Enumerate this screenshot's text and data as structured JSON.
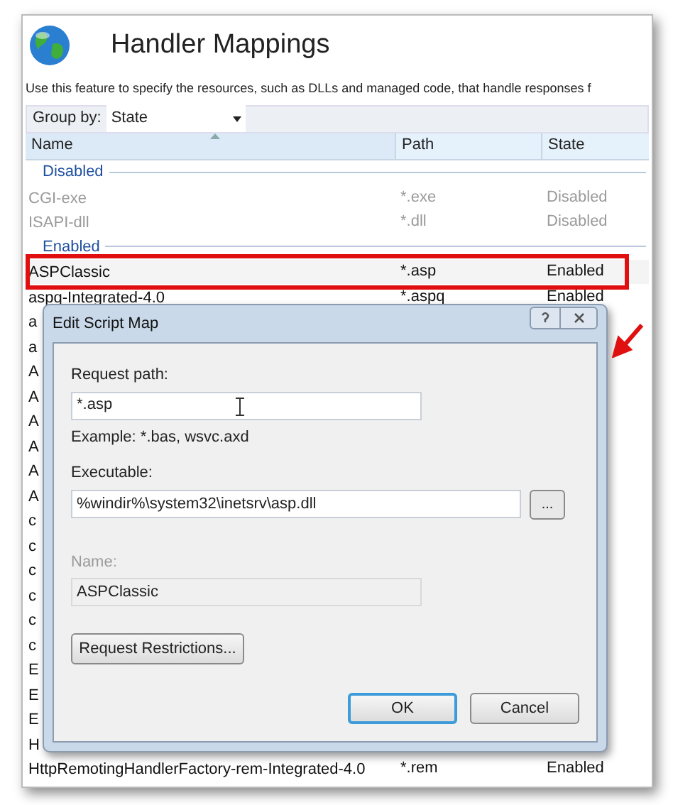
{
  "window": {
    "title": "Handler Mappings",
    "description": "Use this feature to specify the resources, such as DLLs and managed code, that handle responses f"
  },
  "toolbar": {
    "group_by_label": "Group by:",
    "group_by_value": "State"
  },
  "table": {
    "columns": [
      {
        "label": "Name",
        "sorted": true
      },
      {
        "label": "Path",
        "sorted": false
      },
      {
        "label": "State",
        "sorted": false
      }
    ],
    "rows": [
      {
        "kind": "group",
        "label": "Disabled"
      },
      {
        "kind": "item",
        "name": "CGI-exe",
        "path": "*.exe",
        "state": "Disabled",
        "disabled": true,
        "highlighted": false
      },
      {
        "kind": "item",
        "name": "ISAPI-dll",
        "path": "*.dll",
        "state": "Disabled",
        "disabled": true,
        "highlighted": false
      },
      {
        "kind": "group",
        "label": "Enabled"
      },
      {
        "kind": "item",
        "name": "ASPClassic",
        "path": "*.asp",
        "state": "Enabled",
        "disabled": false,
        "highlighted": true
      },
      {
        "kind": "item",
        "name": "aspq-Integrated-4.0",
        "path": "*.aspq",
        "state": "Enabled",
        "disabled": false,
        "highlighted": false
      },
      {
        "kind": "item",
        "name": "a",
        "disabled": false,
        "highlighted": false
      },
      {
        "kind": "item",
        "name": "a",
        "disabled": false,
        "highlighted": false
      },
      {
        "kind": "item",
        "name": "A",
        "disabled": false,
        "highlighted": false
      },
      {
        "kind": "item",
        "name": "A",
        "disabled": false,
        "highlighted": false
      },
      {
        "kind": "item",
        "name": "A",
        "disabled": false,
        "highlighted": false
      },
      {
        "kind": "item",
        "name": "A",
        "disabled": false,
        "highlighted": false
      },
      {
        "kind": "item",
        "name": "A",
        "disabled": false,
        "highlighted": false
      },
      {
        "kind": "item",
        "name": "A",
        "disabled": false,
        "highlighted": false
      },
      {
        "kind": "item",
        "name": "c",
        "disabled": false,
        "highlighted": false
      },
      {
        "kind": "item",
        "name": "c",
        "disabled": false,
        "highlighted": false
      },
      {
        "kind": "item",
        "name": "c",
        "disabled": false,
        "highlighted": false
      },
      {
        "kind": "item",
        "name": "c",
        "disabled": false,
        "highlighted": false
      },
      {
        "kind": "item",
        "name": "c",
        "disabled": false,
        "highlighted": false
      },
      {
        "kind": "item",
        "name": "c",
        "disabled": false,
        "highlighted": false
      },
      {
        "kind": "item",
        "name": "E",
        "disabled": false,
        "highlighted": false
      },
      {
        "kind": "item",
        "name": "E",
        "disabled": false,
        "highlighted": false
      },
      {
        "kind": "item",
        "name": "E",
        "disabled": false,
        "highlighted": false
      },
      {
        "kind": "item",
        "name": "H",
        "disabled": false,
        "highlighted": false
      },
      {
        "kind": "item",
        "name": "HttpRemotingHandlerFactory-rem-Integrated-4.0",
        "path": "*.rem",
        "state": "Enabled",
        "disabled": false,
        "highlighted": false
      }
    ]
  },
  "dialog": {
    "title": "Edit Script Map",
    "request_path_label": "Request path:",
    "request_path": "*.asp",
    "example": "Example: *.bas, wsvc.axd",
    "executable_label": "Executable:",
    "executable": "%windir%\\system32\\inetsrv\\asp.dll",
    "browse_button": "...",
    "name_label": "Name:",
    "name": "ASPClassic",
    "name_disabled": true,
    "restrictions_button": "Request Restrictions...",
    "buttons": [
      {
        "label": "OK",
        "default": true
      },
      {
        "label": "Cancel",
        "default": false
      }
    ]
  }
}
